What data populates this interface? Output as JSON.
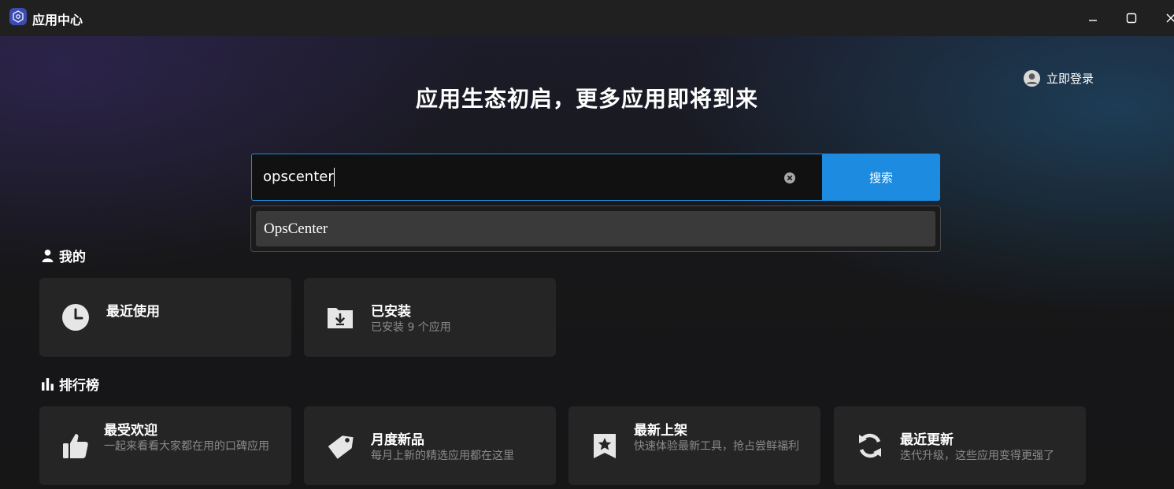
{
  "window": {
    "title": "应用中心"
  },
  "header": {
    "login_label": "立即登录",
    "hero_title": "应用生态初启，更多应用即将到来"
  },
  "search": {
    "value": "opscenter",
    "button_label": "搜索",
    "suggestions": [
      "OpsCenter"
    ]
  },
  "my": {
    "section_title": "我的",
    "cards": [
      {
        "title": "最近使用",
        "desc": "",
        "icon": "clock-icon"
      },
      {
        "title": "已安装",
        "desc": "已安装 9 个应用",
        "icon": "download-folder-icon"
      }
    ]
  },
  "ranking": {
    "section_title": "排行榜",
    "cards": [
      {
        "title": "最受欢迎",
        "desc": "一起来看看大家都在用的口碑应用",
        "icon": "thumbs-up-icon"
      },
      {
        "title": "月度新品",
        "desc": "每月上新的精选应用都在这里",
        "icon": "tag-icon"
      },
      {
        "title": "最新上架",
        "desc": "快速体验最新工具，抢占尝鲜福利",
        "icon": "star-bookmark-icon"
      },
      {
        "title": "最近更新",
        "desc": "迭代升级，这些应用变得更强了",
        "icon": "refresh-icon"
      }
    ]
  },
  "colors": {
    "accent": "#1d8ce0",
    "card_bg": "#252525",
    "titlebar_bg": "#202020"
  }
}
